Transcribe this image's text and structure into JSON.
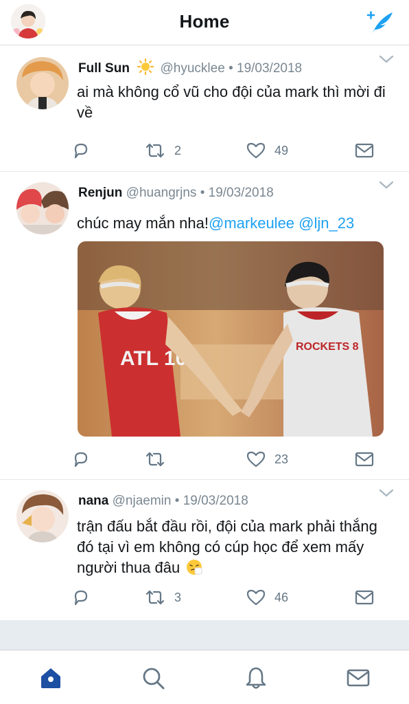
{
  "header": {
    "title": "Home",
    "profile_avatar": "profile-avatar",
    "compose_icon": "compose-tweet-icon",
    "accent_color": "#1da1f2"
  },
  "tweets": [
    {
      "name": "Full Sun",
      "name_emoji": "sun-emoji",
      "handle": "@hyucklee",
      "separator": "•",
      "date": "19/03/2018",
      "text": "ai mà không cổ vũ cho đội của mark thì mời đi về",
      "reply_count": "",
      "retweet_count": "2",
      "like_count": "49"
    },
    {
      "name": "Renjun",
      "handle": "@huangrjns",
      "separator": "•",
      "date": "19/03/2018",
      "text_prefix": "chúc may mắn nha!",
      "mentions": [
        "@markeulee",
        "@ljn_23"
      ],
      "media": {
        "description_icon": "basketball-photo",
        "jersey_left": "ATL 10",
        "jersey_right": "ROCKETS 8"
      },
      "reply_count": "",
      "retweet_count": "",
      "like_count": "23"
    },
    {
      "name": "nana",
      "handle": "@njaemin",
      "separator": "•",
      "date": "19/03/2018",
      "text": "trận đấu bắt đầu rồi, đội của mark phải thắng đó tại vì em không có cúp học để xem mấy người thua đâu",
      "text_emoji": "sneezing-face-emoji",
      "reply_count": "",
      "retweet_count": "3",
      "like_count": "46"
    }
  ],
  "tabs": [
    {
      "name": "home",
      "icon": "home-icon",
      "active": true
    },
    {
      "name": "search",
      "icon": "search-icon",
      "active": false
    },
    {
      "name": "notifications",
      "icon": "bell-icon",
      "active": false
    },
    {
      "name": "messages",
      "icon": "mail-icon",
      "active": false
    }
  ],
  "colors": {
    "accent": "#1da1f2",
    "text_primary": "#14171a",
    "text_secondary": "#657786",
    "divider": "#e6ecf0",
    "icon_gray": "#657786"
  }
}
